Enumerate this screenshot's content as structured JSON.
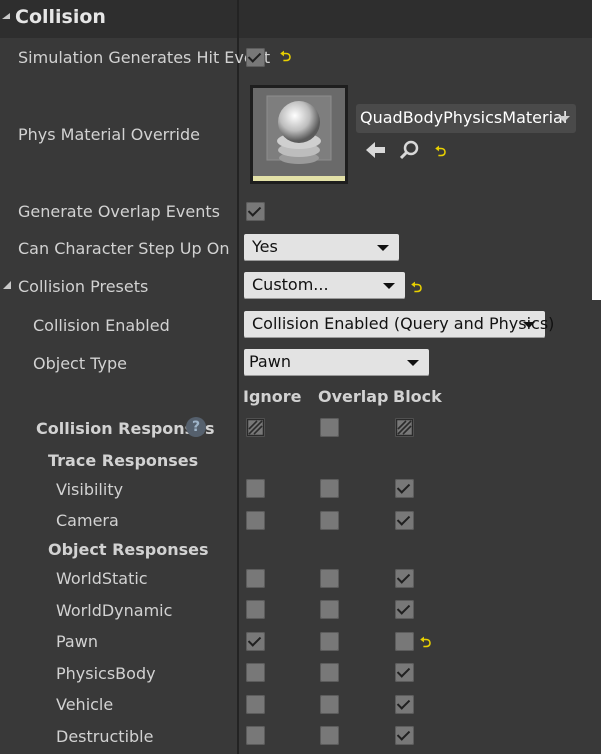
{
  "section": {
    "title": "Collision"
  },
  "rows": {
    "sim_hit": {
      "label": "Simulation Generates Hit Event",
      "checked": true
    },
    "phys_material": {
      "label": "Phys Material Override",
      "value": "QuadBodyPhysicsMaterial"
    },
    "overlap_events": {
      "label": "Generate Overlap Events",
      "checked": true
    },
    "step_up": {
      "label": "Can Character Step Up On",
      "value": "Yes"
    },
    "presets": {
      "label": "Collision Presets",
      "value": "Custom..."
    },
    "enabled": {
      "label": "Collision Enabled",
      "value": "Collision Enabled (Query and Physics)"
    },
    "object_type": {
      "label": "Object Type",
      "value": "Pawn"
    }
  },
  "columns": {
    "ignore": "Ignore",
    "overlap": "Overlap",
    "block": "Block"
  },
  "responses": {
    "title": "Collision Responses",
    "help": "?",
    "trace_title": "Trace Responses",
    "object_title": "Object Responses",
    "trace": [
      {
        "label": "Visibility",
        "ignore": false,
        "overlap": false,
        "block": true
      },
      {
        "label": "Camera",
        "ignore": false,
        "overlap": false,
        "block": true
      }
    ],
    "object": [
      {
        "label": "WorldStatic",
        "ignore": false,
        "overlap": false,
        "block": true
      },
      {
        "label": "WorldDynamic",
        "ignore": false,
        "overlap": false,
        "block": true
      },
      {
        "label": "Pawn",
        "ignore": true,
        "overlap": false,
        "block": false
      },
      {
        "label": "PhysicsBody",
        "ignore": false,
        "overlap": false,
        "block": true
      },
      {
        "label": "Vehicle",
        "ignore": false,
        "overlap": false,
        "block": true
      },
      {
        "label": "Destructible",
        "ignore": false,
        "overlap": false,
        "block": true
      }
    ]
  },
  "reset_glyph": "⮌"
}
